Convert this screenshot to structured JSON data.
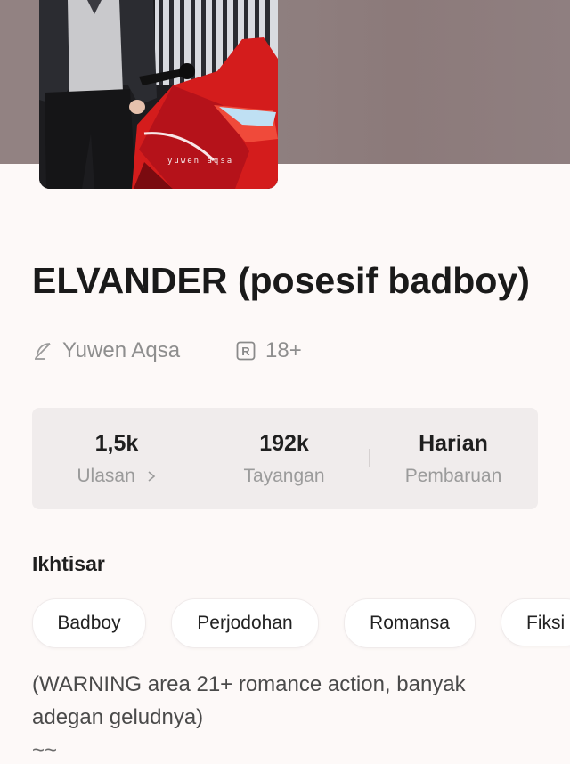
{
  "cover": {
    "caption": "yuwen aqsa"
  },
  "book": {
    "title": "ELVANDER (posesif badboy)"
  },
  "meta": {
    "author": "Yuwen Aqsa",
    "rating": "18+"
  },
  "stats": [
    {
      "value": "1,5k",
      "label": "Ulasan"
    },
    {
      "value": "192k",
      "label": "Tayangan"
    },
    {
      "value": "Harian",
      "label": "Pembaruan"
    }
  ],
  "overview": {
    "title": "Ikhtisar",
    "tags": [
      "Badboy",
      "Perjodohan",
      "Romansa",
      "Fiksi"
    ]
  },
  "synopsis": {
    "text": "(WARNING area 21+ romance action, banyak adegan geludnya)",
    "extra": "~~"
  },
  "colors": {
    "background": "#fdf9f8",
    "hero": "#8f8080",
    "card": "#f0ecec",
    "muted": "#8e8e8e"
  },
  "icons": {
    "author": "feather-pen-icon",
    "rating": "registered-rating-icon",
    "chevron": "chevron-right-icon"
  }
}
